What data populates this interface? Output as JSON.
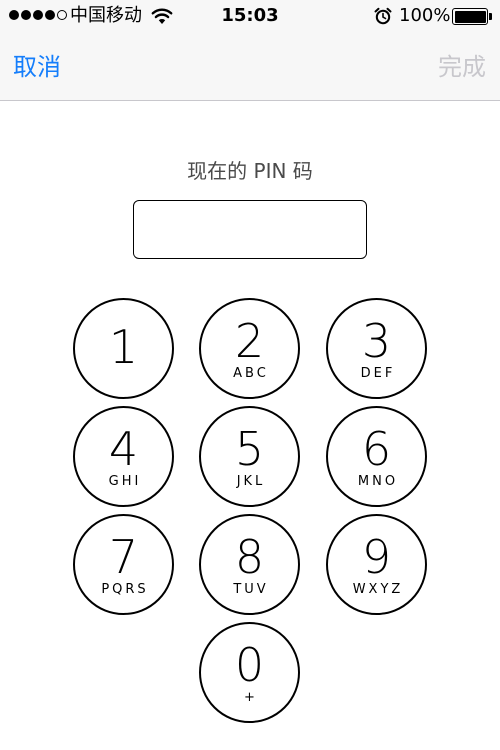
{
  "status_bar": {
    "carrier": "中国移动",
    "time": "15:03",
    "battery_percent": "100%",
    "battery_level": 1.0,
    "signal_bars_filled": 4,
    "signal_bars_total": 5
  },
  "nav": {
    "cancel_label": "取消",
    "done_label": "完成"
  },
  "prompt": "现在的 PIN 码",
  "pin_input": {
    "value": "",
    "placeholder": ""
  },
  "keypad": [
    {
      "num": "1",
      "letters": ""
    },
    {
      "num": "2",
      "letters": "ABC"
    },
    {
      "num": "3",
      "letters": "DEF"
    },
    {
      "num": "4",
      "letters": "GHI"
    },
    {
      "num": "5",
      "letters": "JKL"
    },
    {
      "num": "6",
      "letters": "MNO"
    },
    {
      "num": "7",
      "letters": "PQRS"
    },
    {
      "num": "8",
      "letters": "TUV"
    },
    {
      "num": "9",
      "letters": "WXYZ"
    },
    {
      "num": "0",
      "letters": "+"
    }
  ],
  "colors": {
    "accent": "#157efb",
    "disabled": "#c8c7cc",
    "bar_background": "#f7f7f7"
  },
  "icons": {
    "wifi": "wifi-icon",
    "alarm": "alarm-clock-icon",
    "battery": "battery-icon"
  }
}
